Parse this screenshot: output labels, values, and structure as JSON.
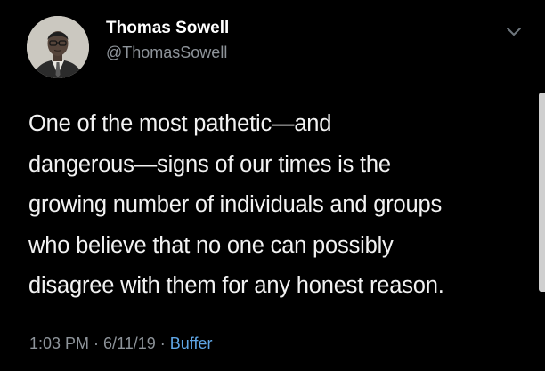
{
  "author": {
    "display_name": "Thomas Sowell",
    "handle": "@ThomasSowell",
    "avatar_icon": "profile-photo"
  },
  "tweet": {
    "lines": [
      "One of the most pathetic—and",
      "dangerous—signs of our times is the",
      "growing number of individuals and groups",
      "who believe that no one can possibly",
      "disagree with them for any honest reason."
    ]
  },
  "meta": {
    "time": "1:03 PM",
    "separator1": " · ",
    "date": "6/11/19",
    "separator2": " · ",
    "source": "Buffer"
  },
  "menu": {
    "icon": "chevron-down-icon"
  },
  "colors": {
    "background": "#000000",
    "text": "#f2f2f2",
    "secondary": "#8e949a",
    "link": "#5fa6e6"
  }
}
